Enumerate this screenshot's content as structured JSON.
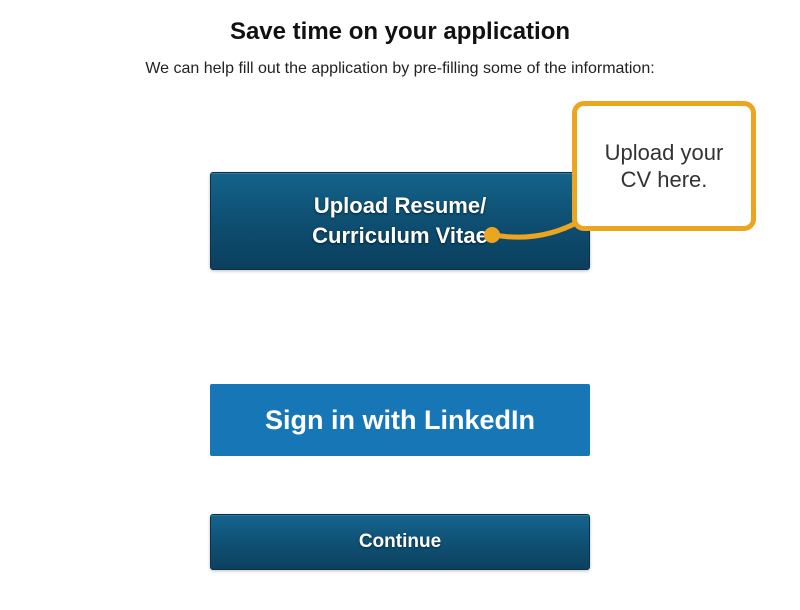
{
  "heading": "Save time on your application",
  "subheading": "We can help fill out the application by pre-filling some of the information:",
  "buttons": {
    "upload_label": "Upload Resume/\nCurriculum Vitae",
    "linkedin_label": "Sign in with LinkedIn",
    "continue_label": "Continue"
  },
  "callout": {
    "text": "Upload your CV here.",
    "accent_color": "#eba51e"
  }
}
